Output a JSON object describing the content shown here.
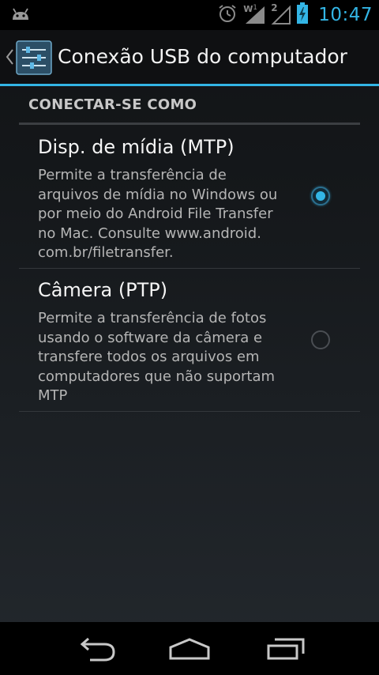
{
  "status_bar": {
    "time": "10:47",
    "wifi_badge": "W",
    "wifi_badge_count": "1",
    "signal_badge": "2",
    "accent_color": "#33b5e5",
    "icons": [
      "android-notification-icon",
      "alarm-icon",
      "wifi-icon",
      "signal-icon",
      "battery-charging-icon"
    ]
  },
  "action_bar": {
    "title": "Conexão USB do computador",
    "icons": [
      "back-caret-icon",
      "settings-icon"
    ]
  },
  "section": {
    "header": "CONECTAR-SE COMO"
  },
  "options": [
    {
      "title": "Disp. de mídia (MTP)",
      "summary_lines": [
        "Permite a transferência de",
        "arquivos de mídia no Windows ou",
        "por meio do Android File Transfer",
        "no Mac. Consulte www.android.",
        "com.br/filetransfer."
      ],
      "checked": true
    },
    {
      "title": "Câmera (PTP)",
      "summary_lines": [
        "Permite a transferência de fotos",
        "usando o software da câmera e",
        "transfere todos os arquivos em",
        "computadores que não suportam",
        "MTP"
      ],
      "checked": false
    }
  ],
  "nav_bar": {
    "icons": [
      "back-icon",
      "home-icon",
      "recent-apps-icon"
    ]
  }
}
